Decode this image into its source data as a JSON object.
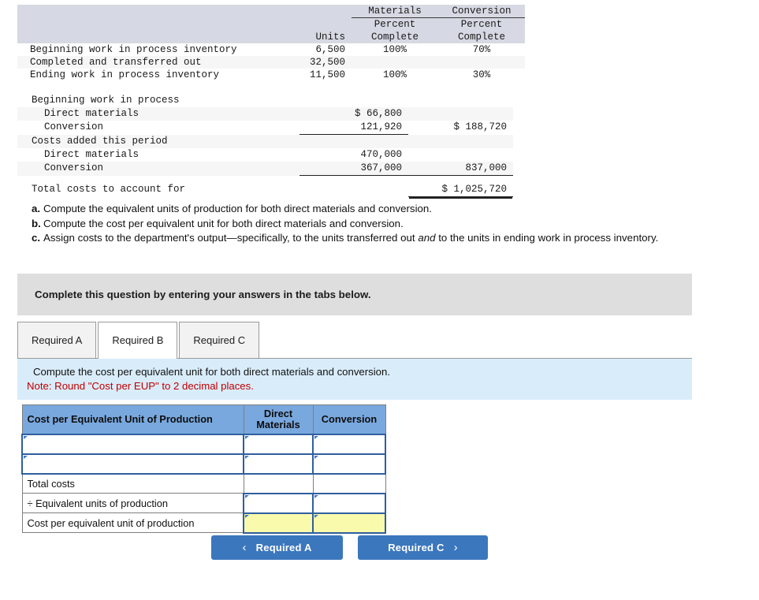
{
  "units_table": {
    "group_headers": [
      "Materials",
      "Conversion"
    ],
    "sub_headers": [
      "Percent",
      "Percent"
    ],
    "col_headers": [
      "Units",
      "Complete",
      "Complete"
    ],
    "rows": [
      {
        "label": "Beginning work in process inventory",
        "units": "6,500",
        "materials": "100%",
        "conversion": "70%"
      },
      {
        "label": "Completed and transferred out",
        "units": "32,500",
        "materials": "",
        "conversion": ""
      },
      {
        "label": "Ending work in process inventory",
        "units": "11,500",
        "materials": "100%",
        "conversion": "30%"
      }
    ]
  },
  "costs_table": {
    "rows": [
      {
        "label": "Beginning work in process",
        "col1": "",
        "col2": ""
      },
      {
        "label": "Direct materials",
        "col1": "$ 66,800",
        "col2": ""
      },
      {
        "label": "Conversion",
        "col1": "121,920",
        "col2": "$ 188,720"
      },
      {
        "label": "Costs added this period",
        "col1": "",
        "col2": ""
      },
      {
        "label": "Direct materials",
        "col1": "470,000",
        "col2": ""
      },
      {
        "label": "Conversion",
        "col1": "367,000",
        "col2": "837,000"
      },
      {
        "label": "Total costs to account for",
        "col1": "",
        "col2": "$ 1,025,720"
      }
    ]
  },
  "questions": [
    {
      "key": "a.",
      "text": "Compute the equivalent units of production for both direct materials and conversion."
    },
    {
      "key": "b.",
      "text": "Compute the cost per equivalent unit for both direct materials and conversion."
    },
    {
      "key": "c.",
      "text_pre": "Assign costs to the department's output—specifically, to the units transferred out ",
      "text_em": "and",
      "text_post": " to the units in ending work in process inventory."
    }
  ],
  "instruction_bar": {
    "text": "Complete this question by entering your answers in the tabs below."
  },
  "tabs": [
    {
      "label": "Required A",
      "active": false
    },
    {
      "label": "Required B",
      "active": true
    },
    {
      "label": "Required C",
      "active": false
    }
  ],
  "blue_panel": {
    "prompt": "Compute the cost per equivalent unit for both direct materials and conversion.",
    "note": "Note: Round \"Cost per EUP\" to 2 decimal places."
  },
  "answer_grid": {
    "headers": {
      "row_label": "Cost per Equivalent Unit of Production",
      "direct_materials": "Direct\nMaterials",
      "direct_materials_line1": "Direct",
      "direct_materials_line2": "Materials",
      "conversion": "Conversion"
    },
    "rows": [
      {
        "label": "",
        "type": "input",
        "dm": "",
        "cv": "",
        "label_input": true
      },
      {
        "label": "",
        "type": "input",
        "dm": "",
        "cv": "",
        "label_input": true
      },
      {
        "label": "Total costs",
        "type": "plain",
        "dm": "",
        "cv": "",
        "label_input": false
      },
      {
        "label": "÷ Equivalent units of production",
        "type": "input",
        "dm": "",
        "cv": "",
        "label_input": false
      },
      {
        "label": "Cost per equivalent unit of production",
        "type": "result",
        "dm": "",
        "cv": "",
        "label_input": false
      }
    ]
  },
  "nav": {
    "prev_label": "Required A",
    "next_label": "Required C",
    "prev_chevron": "‹",
    "next_chevron": "›"
  },
  "colors": {
    "button_blue": "#3b77bd",
    "header_blue": "#79a8de",
    "panel_blue": "#d9ecfa",
    "gray_bar": "#dedede",
    "table_band": "#d6d9e3",
    "result_yellow": "#fafaad",
    "note_red": "#c00000"
  }
}
